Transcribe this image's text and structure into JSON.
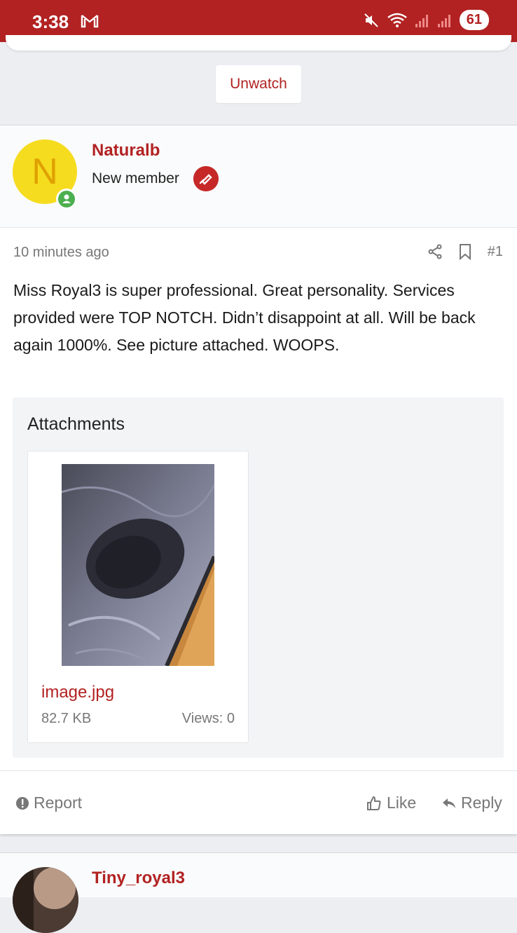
{
  "status_bar": {
    "time": "3:38",
    "battery": "61"
  },
  "watch_button": {
    "label": "Unwatch"
  },
  "post": {
    "author": {
      "name": "Naturalb",
      "role": "New member",
      "avatar_letter": "N"
    },
    "time_ago": "10 minutes ago",
    "post_number": "#1",
    "body": "Miss Royal3 is super professional. Great personality. Services provided were TOP NOTCH. Didn’t disappoint at all. Will be back again 1000%. See picture attached. WOOPS.",
    "attachments": {
      "title": "Attachments",
      "file": {
        "name": "image.jpg",
        "size": "82.7 KB",
        "views": "Views: 0"
      }
    },
    "actions": {
      "report": "Report",
      "like": "Like",
      "reply": "Reply"
    }
  },
  "next_post": {
    "author": "Tiny_royal3"
  },
  "colors": {
    "brand": "#b22222",
    "online": "#4caf50",
    "avatar_bg": "#f5dc1f"
  }
}
